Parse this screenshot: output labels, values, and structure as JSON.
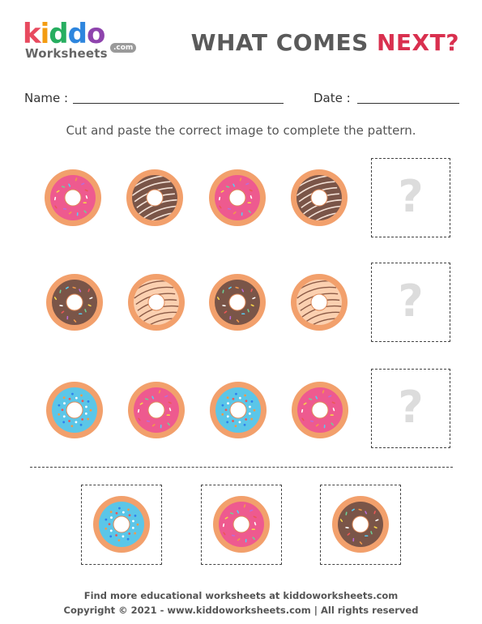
{
  "logo": {
    "letters": [
      {
        "char": "k",
        "color": "#e84a5f"
      },
      {
        "char": "i",
        "color": "#f39c12"
      },
      {
        "char": "d",
        "color": "#27ae60"
      },
      {
        "char": "d",
        "color": "#2e86de"
      },
      {
        "char": "o",
        "color": "#8e44ad"
      }
    ],
    "worksheets": "Worksheets",
    "com": ".com"
  },
  "title": {
    "part1": "WHAT COMES ",
    "part2": "NEXT?"
  },
  "fields": {
    "name_label": "Name :",
    "date_label": "Date :"
  },
  "instruction": "Cut and paste the correct image to complete the pattern.",
  "question_mark": "?",
  "rows": [
    [
      "pink",
      "chocolate-stripe",
      "pink",
      "chocolate-stripe"
    ],
    [
      "chocolate-sprinkle",
      "peach-drizzle",
      "chocolate-sprinkle",
      "peach-drizzle"
    ],
    [
      "blue",
      "pink",
      "blue",
      "pink"
    ]
  ],
  "options": [
    "blue",
    "pink",
    "chocolate-sprinkle"
  ],
  "colors": {
    "dough": "#f2a06c",
    "pink": "#ee5a8f",
    "chocolate": "#7a5548",
    "peach": "#fbd0b0",
    "blue": "#5bc6e8",
    "accent_title": "#d9304f"
  },
  "footer": {
    "line1": "Find more educational worksheets at kiddoworksheets.com",
    "line2": "Copyright © 2021 - www.kiddoworksheets.com  |  All rights reserved"
  }
}
